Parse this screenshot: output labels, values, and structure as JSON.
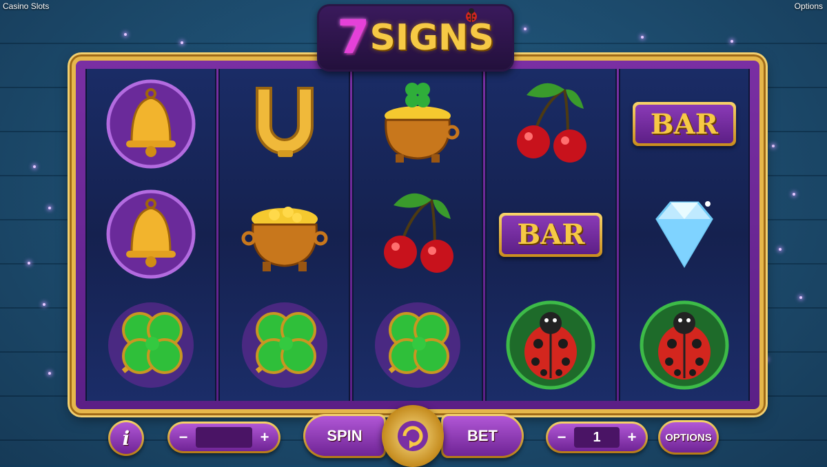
{
  "app": {
    "title": "Casino Slots",
    "options_link": "Options"
  },
  "logo": {
    "seven": "7",
    "signs": "SIGNS"
  },
  "reels": [
    [
      "bell-icon",
      "bell-icon",
      "clover-icon"
    ],
    [
      "horseshoe-icon",
      "pot-of-gold-icon",
      "clover-icon"
    ],
    [
      "pot-of-gold-clover-icon",
      "cherry-icon",
      "clover-icon"
    ],
    [
      "cherry-icon",
      "bar-symbol",
      "ladybug-icon"
    ],
    [
      "bar-symbol",
      "diamond-icon",
      "ladybug-icon"
    ]
  ],
  "bar_text": "BAR",
  "controls": {
    "info_label": "i",
    "minus": "−",
    "plus": "+",
    "lines_value": "",
    "spin_label": "SPIN",
    "bet_label": "BET",
    "bet_value": "1",
    "options_label": "OPTIONS"
  },
  "colors": {
    "frame_gold": "#e6b74a",
    "button_purple": "#8c3cb6",
    "background": "#17496d",
    "bar_gold": "#f6c945"
  }
}
